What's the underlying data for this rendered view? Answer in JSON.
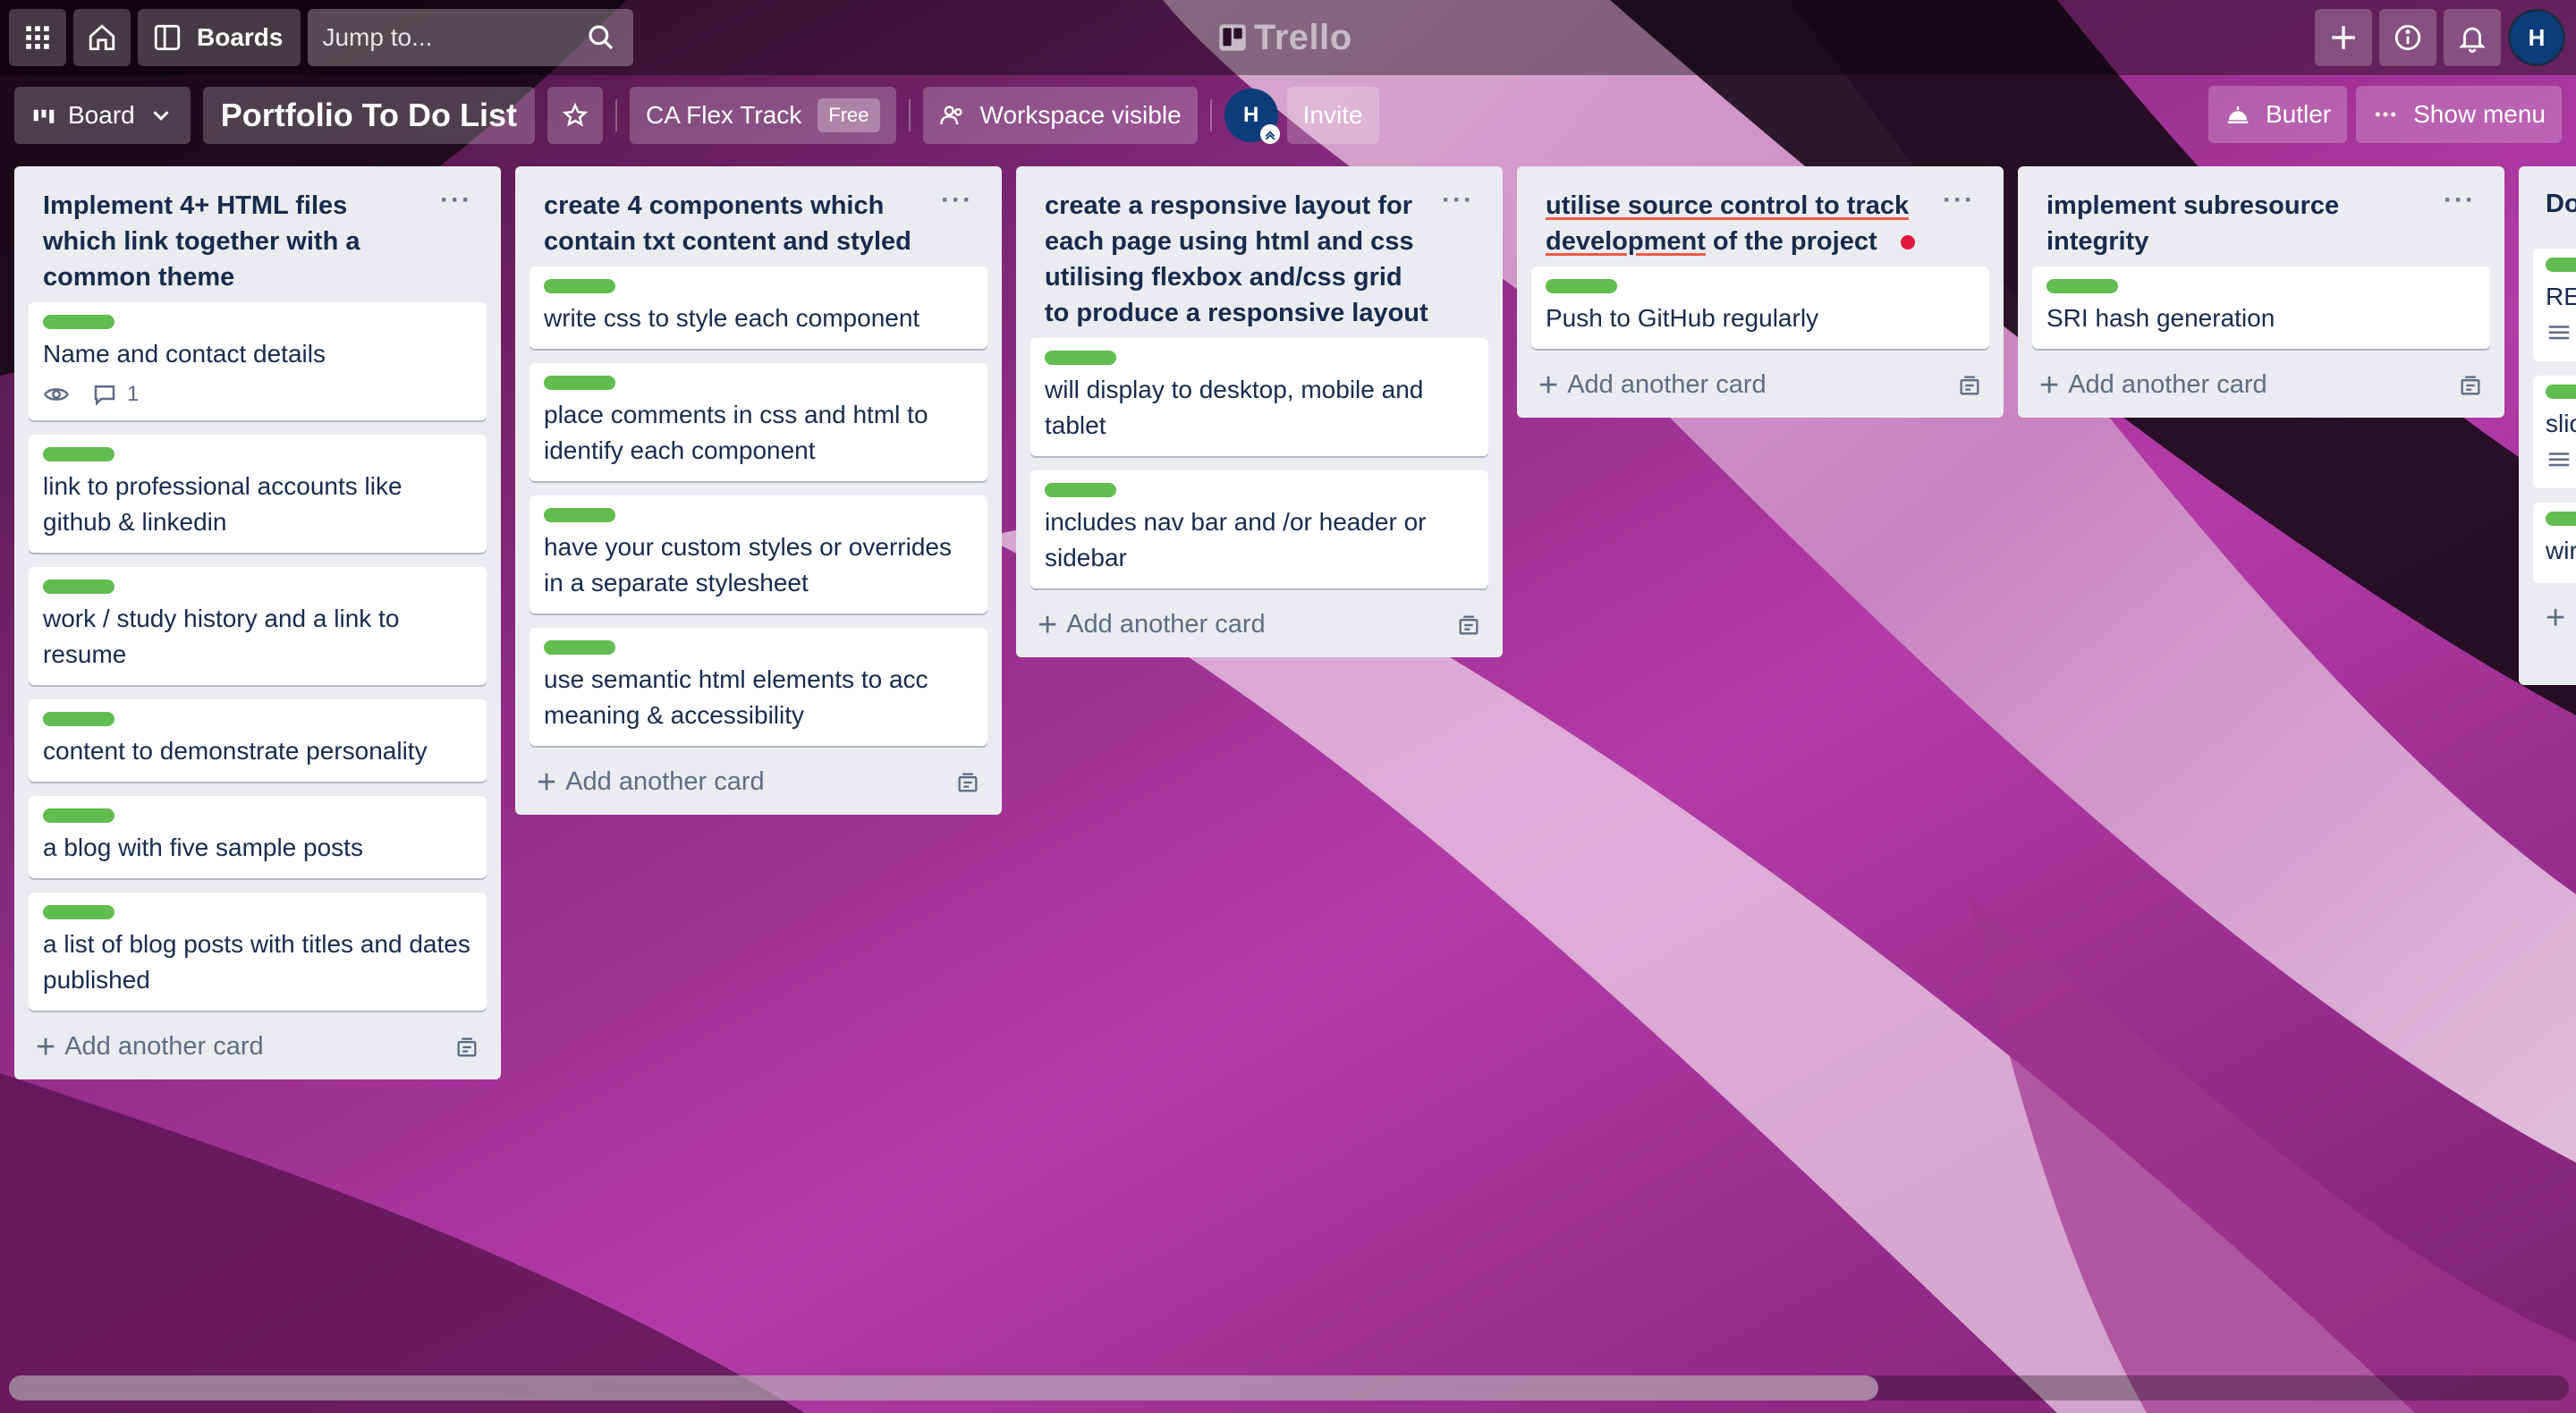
{
  "app": {
    "logo_text": "Trello"
  },
  "topbar": {
    "boards_label": "Boards",
    "search_placeholder": "Jump to..."
  },
  "user": {
    "initial": "H"
  },
  "board": {
    "view_label": "Board",
    "title": "Portfolio To Do List",
    "workspace_name": "CA Flex Track",
    "workspace_plan": "Free",
    "visibility_label": "Workspace visible",
    "invite_label": "Invite",
    "butler_label": "Butler",
    "show_menu_label": "Show menu"
  },
  "add_card_label": "Add another card",
  "lists": [
    {
      "title": "Implement 4+ HTML files which link together with a common theme",
      "cards": [
        {
          "text": "Name and contact details",
          "comments": "1",
          "watching": true
        },
        {
          "text": "link to professional accounts like github & linkedin"
        },
        {
          "text": "work / study history and a link to resume"
        },
        {
          "text": "content to demonstrate personality"
        },
        {
          "text": "a blog with five sample posts"
        },
        {
          "text": "a list of blog posts with titles and dates published"
        }
      ]
    },
    {
      "title": "create 4 components which contain txt content and styled",
      "cards": [
        {
          "text": "write css to style each component"
        },
        {
          "text": "place comments in css and html to identify each component"
        },
        {
          "text": "have your custom styles or overrides in a separate stylesheet"
        },
        {
          "text": "use semantic html elements to acc meaning & accessibility"
        }
      ]
    },
    {
      "title": "create a responsive layout for each page using html and css utilising flexbox and/css grid to produce a responsive layout",
      "cards": [
        {
          "text": "will display to desktop, mobile and tablet"
        },
        {
          "text": "includes nav bar and /or header or sidebar"
        }
      ]
    },
    {
      "title_part1": "utilise source control to track development",
      "title_part2": " of the project",
      "cards": [
        {
          "text": "Push to GitHub regularly"
        }
      ]
    },
    {
      "title": "implement subresource integrity",
      "cards": [
        {
          "text": "SRI hash generation"
        }
      ]
    },
    {
      "title": "Do",
      "cards": [
        {
          "text": "RE"
        },
        {
          "text": "slic"
        },
        {
          "text": "wir"
        }
      ]
    }
  ],
  "colors": {
    "label_green": "#61bd4f",
    "list_bg": "#ebecf0",
    "text_primary": "#172b4d"
  }
}
